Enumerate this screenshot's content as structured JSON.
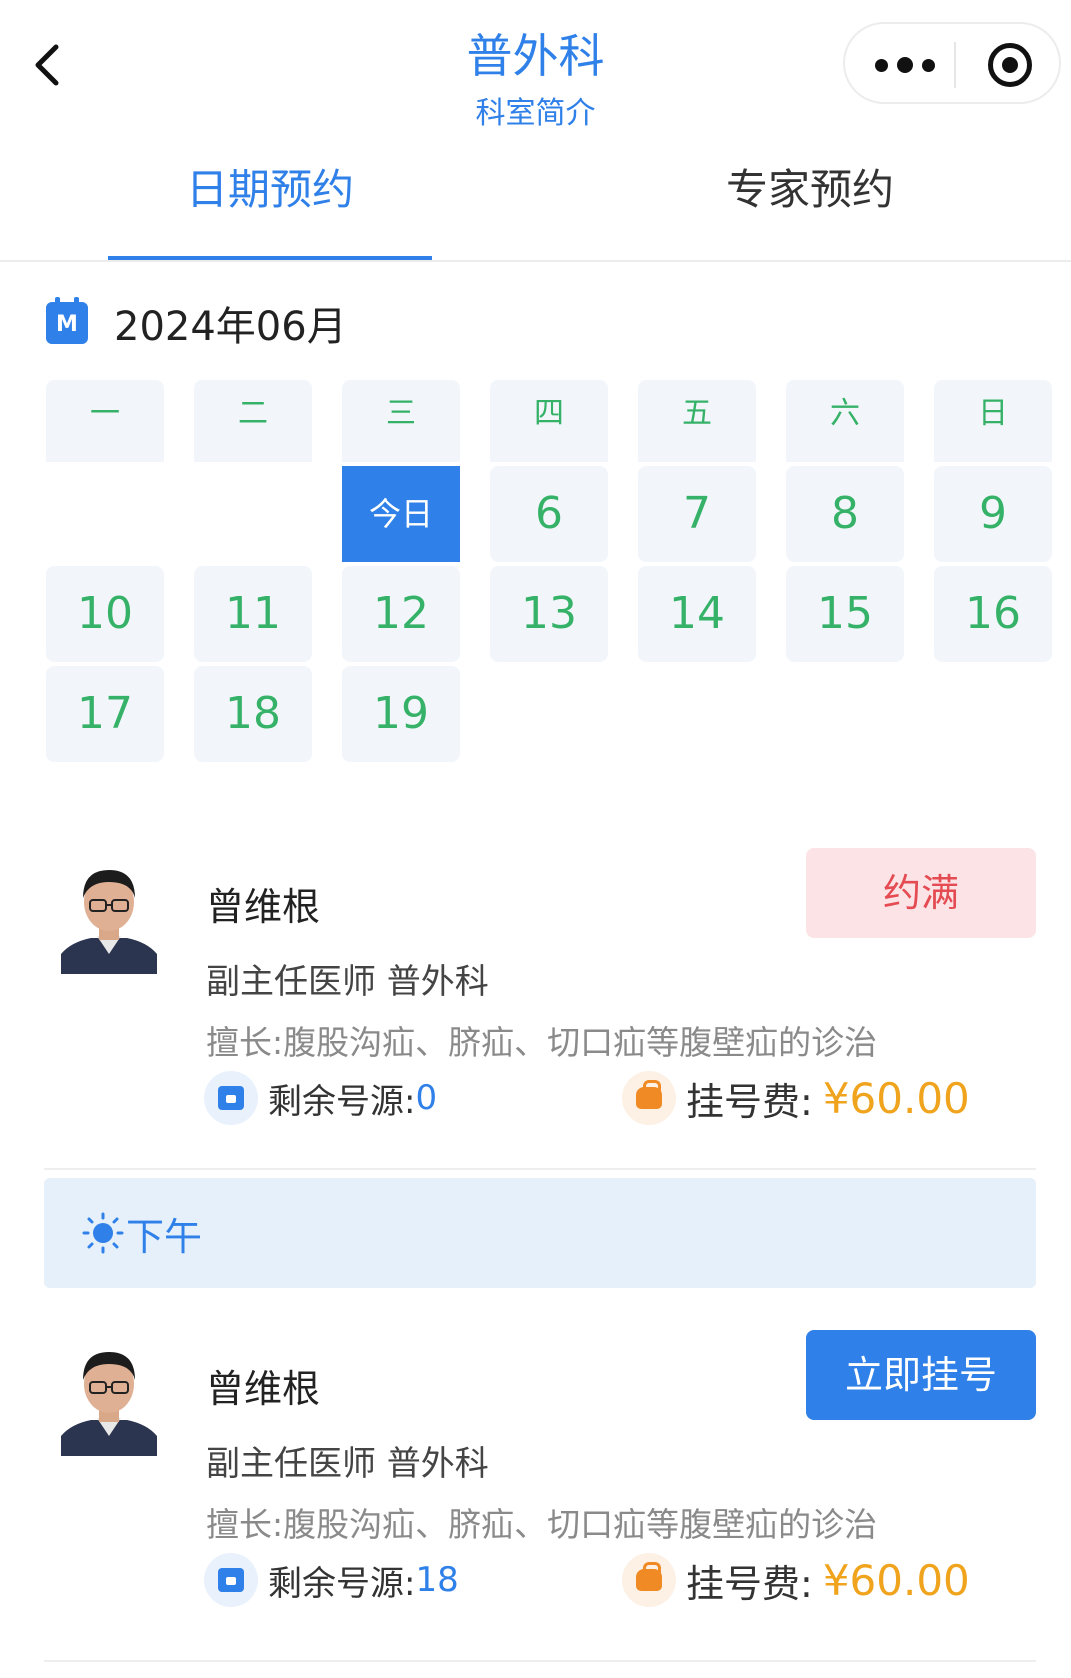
{
  "header": {
    "title": "普外科",
    "subtitle": "科室简介"
  },
  "tabs": [
    {
      "label": "日期预约",
      "active": true
    },
    {
      "label": "专家预约",
      "active": false
    }
  ],
  "calendar": {
    "month_label": "2024年06月",
    "icon_letter": "M",
    "weekdays": [
      "一",
      "二",
      "三",
      "四",
      "五",
      "六",
      "日"
    ],
    "rows": [
      [
        "",
        "",
        "今日",
        "6",
        "7",
        "8",
        "9"
      ],
      [
        "10",
        "11",
        "12",
        "13",
        "14",
        "15",
        "16"
      ],
      [
        "17",
        "18",
        "19",
        "",
        "",
        "",
        ""
      ]
    ]
  },
  "doctors": [
    {
      "name": "曾维根",
      "title": "副主任医师 普外科",
      "skill": "擅长:腹股沟疝、脐疝、切口疝等腹壁疝的诊治",
      "remain_label": "剩余号源:",
      "remain_value": "0",
      "fee_label": "挂号费:",
      "fee_value": "¥60.00",
      "action": "约满",
      "status_color": "#e44b52"
    },
    {
      "name": "曾维根",
      "title": "副主任医师 普外科",
      "skill": "擅长:腹股沟疝、脐疝、切口疝等腹壁疝的诊治",
      "remain_label": "剩余号源:",
      "remain_value": "18",
      "fee_label": "挂号费:",
      "fee_value": "¥60.00",
      "action": "立即挂号",
      "status_color": "#2f80e8"
    }
  ],
  "afternoon_section": {
    "label": "下午",
    "icon": "sun-icon"
  },
  "colors": {
    "accent": "#2f80e8",
    "date_green": "#35b268",
    "fee_orange": "#f0a31c",
    "full_red": "#e44b52"
  }
}
